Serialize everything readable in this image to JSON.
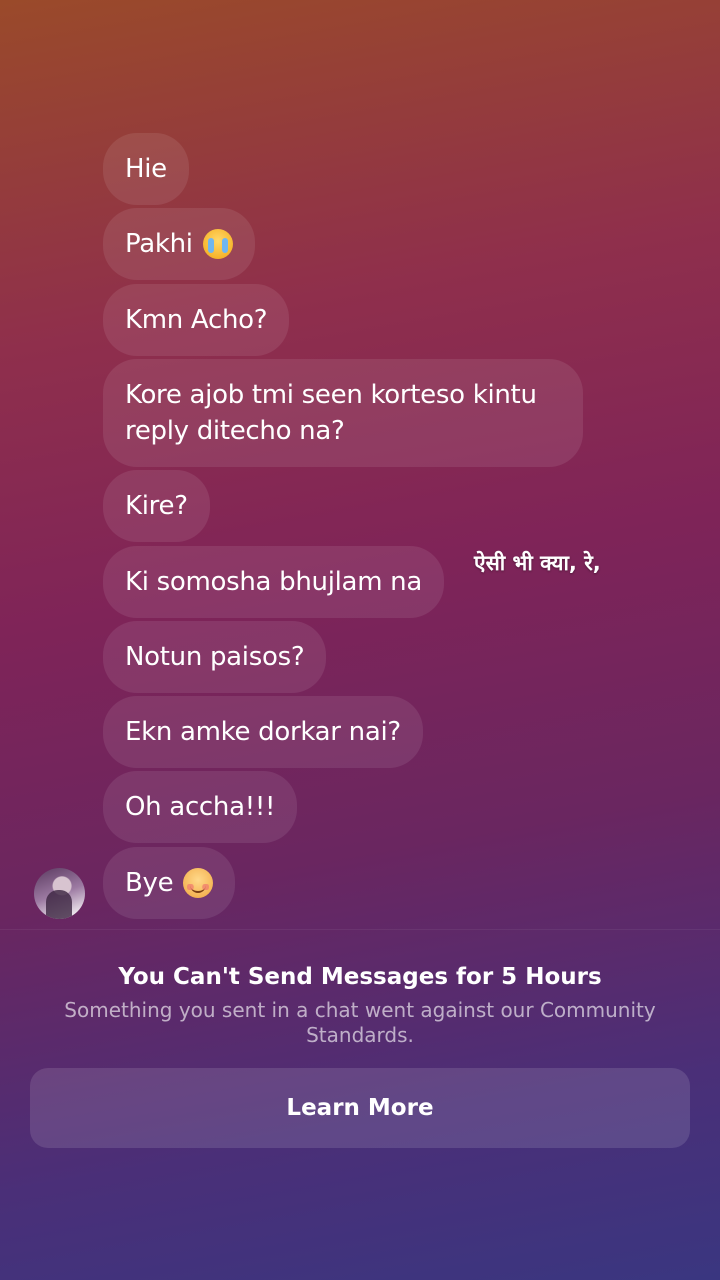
{
  "messages": [
    {
      "text": "Hie"
    },
    {
      "text": "Pakhi",
      "emoji": "loudly-crying-face-emoji"
    },
    {
      "text": "Kmn Acho?"
    },
    {
      "text": "Kore ajob tmi seen korteso kintu\nreply ditecho na?"
    },
    {
      "text": "Kire?"
    },
    {
      "text": "Ki somosha bhujlam na"
    },
    {
      "text": "Notun paisos?"
    },
    {
      "text": "Ekn amke dorkar nai?"
    },
    {
      "text": "Oh accha!!!"
    },
    {
      "text": "Bye",
      "emoji": "smiling-face-emoji"
    }
  ],
  "overlay": {
    "caption": "ऐसी भी क्या, रे,"
  },
  "restriction": {
    "title": "You Can't Send Messages for 5 Hours",
    "body": "Something you sent in a chat went against our Community Standards.",
    "button_label": "Learn More"
  },
  "colors": {
    "bubble": "rgba(255,255,255,0.09)",
    "gradient_top": "#9a4a2a",
    "gradient_mid": "#7f2458",
    "gradient_bottom": "#3a3680"
  }
}
